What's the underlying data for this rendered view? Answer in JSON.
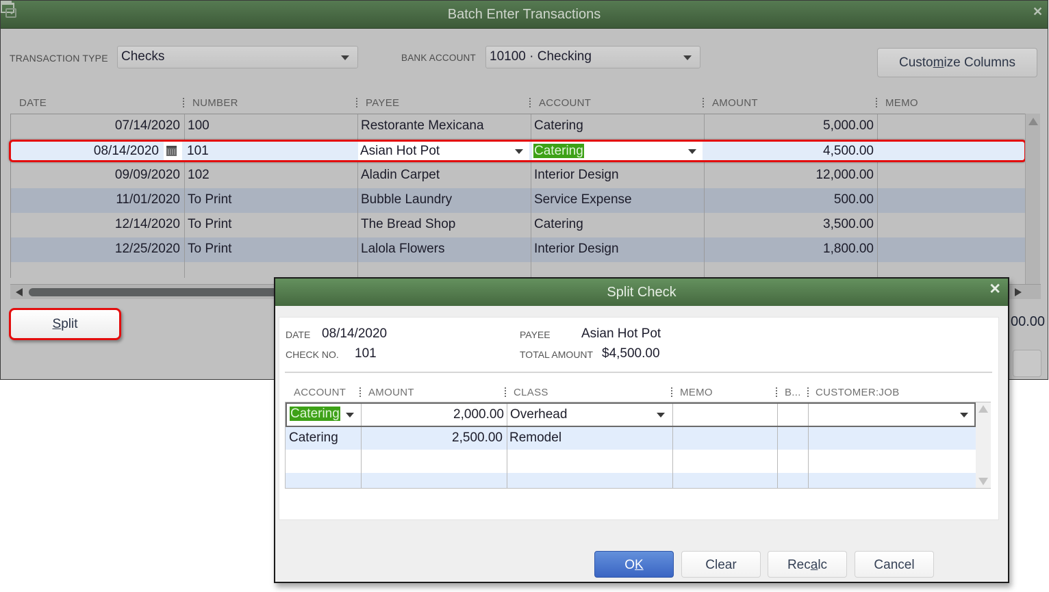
{
  "main_window": {
    "title": "Batch Enter Transactions",
    "controls": {
      "minimize": "minimize",
      "maximize": "maximize",
      "close": "✕"
    },
    "transaction_type": {
      "label": "TRANSACTION TYPE",
      "value": "Checks"
    },
    "bank_account": {
      "label": "BANK ACCOUNT",
      "value": "10100 · Checking"
    },
    "customize_columns": {
      "pre": "Custo",
      "accel": "m",
      "post": "ize Columns"
    },
    "columns": [
      "DATE",
      "NUMBER",
      "PAYEE",
      "ACCOUNT",
      "AMOUNT",
      "MEMO"
    ],
    "rows": [
      {
        "date": "07/14/2020",
        "number": "100",
        "payee": "Restorante Mexicana",
        "account": "Catering",
        "amount": "5,000.00",
        "memo": ""
      },
      {
        "date": "08/14/2020",
        "number": "101",
        "payee": "Asian Hot Pot",
        "account": "Catering",
        "amount": "4,500.00",
        "memo": "",
        "selected": true
      },
      {
        "date": "09/09/2020",
        "number": "102",
        "payee": "Aladin Carpet",
        "account": "Interior Design",
        "amount": "12,000.00",
        "memo": ""
      },
      {
        "date": "11/01/2020",
        "number": "To Print",
        "payee": "Bubble Laundry",
        "account": "Service Expense",
        "amount": "500.00",
        "memo": ""
      },
      {
        "date": "12/14/2020",
        "number": "To Print",
        "payee": "The Bread Shop",
        "account": "Catering",
        "amount": "3,500.00",
        "memo": ""
      },
      {
        "date": "12/25/2020",
        "number": "To Print",
        "payee": "Lalola Flowers",
        "account": "Interior Design",
        "amount": "1,800.00",
        "memo": ""
      }
    ],
    "split_button": {
      "accel": "S",
      "post": "plit"
    },
    "partial_total": "00.00"
  },
  "split_dialog": {
    "title": "Split Check",
    "close": "✕",
    "date_label": "DATE",
    "date": "08/14/2020",
    "check_no_label": "CHECK NO.",
    "check_no": "101",
    "payee_label": "PAYEE",
    "payee": "Asian Hot Pot",
    "total_label": "TOTAL AMOUNT",
    "total": "$4,500.00",
    "columns": [
      "ACCOUNT",
      "AMOUNT",
      "CLASS",
      "MEMO",
      "B...",
      "CUSTOMER:JOB"
    ],
    "rows": [
      {
        "account": "Catering",
        "amount": "2,000.00",
        "class": "Overhead",
        "memo": "",
        "billable": "",
        "customer_job": ""
      },
      {
        "account": "Catering",
        "amount": "2,500.00",
        "class": "Remodel",
        "memo": "",
        "billable": "",
        "customer_job": ""
      }
    ],
    "buttons": {
      "ok": {
        "pre": "O",
        "accel": "K",
        "post": ""
      },
      "clear": "Clear",
      "recalc": {
        "pre": "Rec",
        "accel": "a",
        "post": "lc"
      },
      "cancel": "Cancel"
    }
  },
  "colors": {
    "title_bar": "#4a6b45",
    "highlight_border": "#e30d0d",
    "selection_green": "#3da117",
    "ok_blue": "#3a65c3"
  }
}
